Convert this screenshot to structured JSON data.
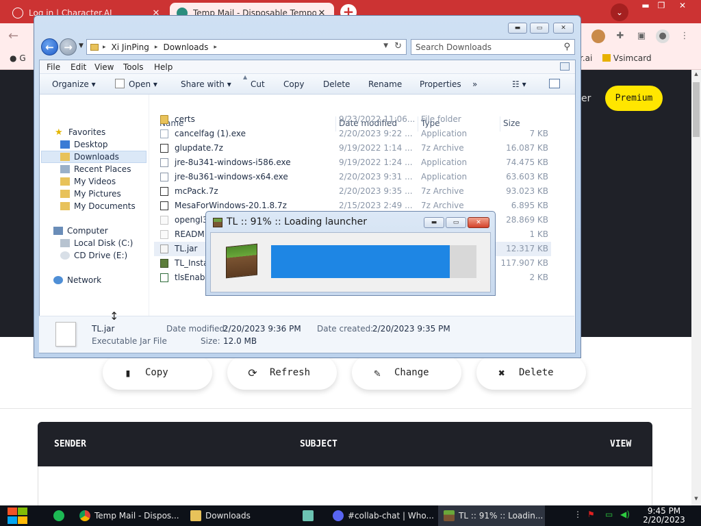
{
  "browser": {
    "tabs": [
      {
        "title": "Log in | Character.AI",
        "close": "✕"
      },
      {
        "title": "Temp Mail - Disposable Temporary Email",
        "close": "✕"
      }
    ],
    "new_tab": "+",
    "tab_search": "⌄",
    "window_controls": {
      "minimize": "▬",
      "restore": "❐",
      "close": "✕"
    },
    "bookmarks": [
      {
        "label": "G"
      },
      {
        "label": "r.ai"
      },
      {
        "label": "Vsimcard"
      }
    ]
  },
  "page": {
    "premium_label": "Premium",
    "actions": [
      {
        "icon": "clipboard-icon",
        "glyph": "▮",
        "label": "Copy"
      },
      {
        "icon": "refresh-icon",
        "glyph": "⟳",
        "label": "Refresh"
      },
      {
        "icon": "edit-icon",
        "glyph": "✎",
        "label": "Change"
      },
      {
        "icon": "x-icon",
        "glyph": "✖",
        "label": "Delete"
      }
    ],
    "inbox_columns": {
      "sender": "SENDER",
      "subject": "SUBJECT",
      "view": "VIEW"
    }
  },
  "explorer": {
    "breadcrumb": [
      "Xi JinPing",
      "Downloads"
    ],
    "search_placeholder": "Search Downloads",
    "menu": [
      "File",
      "Edit",
      "View",
      "Tools",
      "Help"
    ],
    "commands": [
      "Organize ▾",
      "Open ▾",
      "Share with ▾",
      "Cut",
      "Copy",
      "Delete",
      "Rename",
      "Properties",
      "»"
    ],
    "nav": {
      "favorites": "Favorites",
      "favorite_items": [
        "Desktop",
        "Downloads",
        "Recent Places",
        "My Videos",
        "My Pictures",
        "My Documents"
      ],
      "computer": "Computer",
      "drives": [
        "Local Disk (C:)",
        "CD Drive (E:)"
      ],
      "network": "Network"
    },
    "columns": [
      "Name",
      "Date modified",
      "Type",
      "Size"
    ],
    "files": [
      {
        "name": "certs",
        "date": "9/23/2022 11:06...",
        "type": "File folder",
        "size": "",
        "kind": "folder"
      },
      {
        "name": "cancelfag (1).exe",
        "date": "2/20/2023 9:22 ...",
        "type": "Application",
        "size": "7 KB",
        "kind": "app"
      },
      {
        "name": "glupdate.7z",
        "date": "9/19/2022 1:14 ...",
        "type": "7z Archive",
        "size": "16.087 KB",
        "kind": "archive"
      },
      {
        "name": "jre-8u341-windows-i586.exe",
        "date": "9/19/2022 1:24 ...",
        "type": "Application",
        "size": "74.475 KB",
        "kind": "java"
      },
      {
        "name": "jre-8u361-windows-x64.exe",
        "date": "2/20/2023 9:31 ...",
        "type": "Application",
        "size": "63.603 KB",
        "kind": "java"
      },
      {
        "name": "mcPack.7z",
        "date": "2/20/2023 9:35 ...",
        "type": "7z Archive",
        "size": "93.023 KB",
        "kind": "archive"
      },
      {
        "name": "MesaForWindows-20.1.8.7z",
        "date": "2/15/2023 2:49 ...",
        "type": "7z Archive",
        "size": "6.895 KB",
        "kind": "archive"
      },
      {
        "name": "opengl32",
        "date": "",
        "type": "",
        "size": "28.869 KB",
        "kind": "doc"
      },
      {
        "name": "READM",
        "date": "",
        "type": "",
        "size": "1 KB",
        "kind": "doc"
      },
      {
        "name": "TL.jar",
        "date": "",
        "type": "",
        "size": "12.317 KB",
        "kind": "jar"
      },
      {
        "name": "TL_Insta",
        "date": "",
        "type": "",
        "size": "117.907 KB",
        "kind": "block"
      },
      {
        "name": "tlsEnable",
        "date": "",
        "type": "",
        "size": "2 KB",
        "kind": "script"
      }
    ],
    "details": {
      "name": "TL.jar",
      "kind": "Executable Jar File",
      "date_modified_label": "Date modified:",
      "date_modified": "2/20/2023 9:36 PM",
      "date_created_label": "Date created:",
      "date_created": "2/20/2023 9:35 PM",
      "size_label": "Size:",
      "size": "12.0 MB"
    }
  },
  "launcher": {
    "title": "TL :: 91% :: Loading launcher",
    "progress": 0.87
  },
  "taskbar": {
    "items": [
      {
        "label": "Temp Mail - Dispos...",
        "icon": "chrome-icon"
      },
      {
        "label": "Downloads",
        "icon": "folder-icon"
      },
      {
        "label": "#collab-chat | Who...",
        "icon": "discord-icon"
      },
      {
        "label": "TL :: 91% :: Loadin...",
        "icon": "minecraft-icon"
      }
    ],
    "time": "9:45 PM",
    "date": "2/20/2023"
  },
  "colors": {
    "browser_accent": "#cc3333",
    "page_dark": "#1f2128",
    "premium": "#ffe600",
    "progress": "#1e86e4"
  }
}
